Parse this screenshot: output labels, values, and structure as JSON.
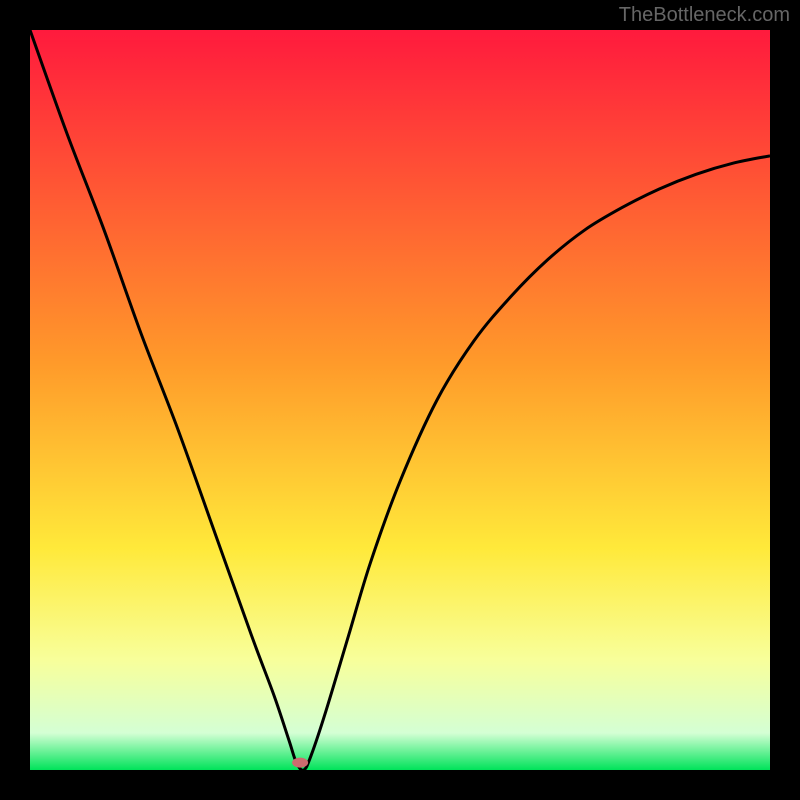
{
  "watermark": "TheBottleneck.com",
  "chart_data": {
    "type": "line",
    "title": "",
    "xlabel": "",
    "ylabel": "",
    "xlim": [
      0,
      100
    ],
    "ylim": [
      0,
      100
    ],
    "grid": false,
    "legend": false,
    "background_gradient": {
      "stops": [
        {
          "offset": 0.0,
          "color": "#ff1a3d"
        },
        {
          "offset": 0.45,
          "color": "#ff9a2a"
        },
        {
          "offset": 0.7,
          "color": "#ffe93a"
        },
        {
          "offset": 0.85,
          "color": "#f8ff9a"
        },
        {
          "offset": 0.95,
          "color": "#d4ffd4"
        },
        {
          "offset": 1.0,
          "color": "#00e35a"
        }
      ]
    },
    "series": [
      {
        "name": "bottleneck-curve",
        "x": [
          0,
          5,
          10,
          15,
          20,
          25,
          30,
          33,
          35,
          36,
          37,
          38,
          40,
          43,
          46,
          50,
          55,
          60,
          65,
          70,
          75,
          80,
          85,
          90,
          95,
          100
        ],
        "values": [
          100,
          86,
          73,
          59,
          46,
          32,
          18,
          10,
          4,
          1,
          0,
          2,
          8,
          18,
          28,
          39,
          50,
          58,
          64,
          69,
          73,
          76,
          78.5,
          80.5,
          82,
          83
        ]
      }
    ],
    "marker": {
      "name": "optimal-point",
      "x": 36.5,
      "y": 1,
      "color": "#cc6b6f",
      "rx": 8,
      "ry": 5
    }
  }
}
